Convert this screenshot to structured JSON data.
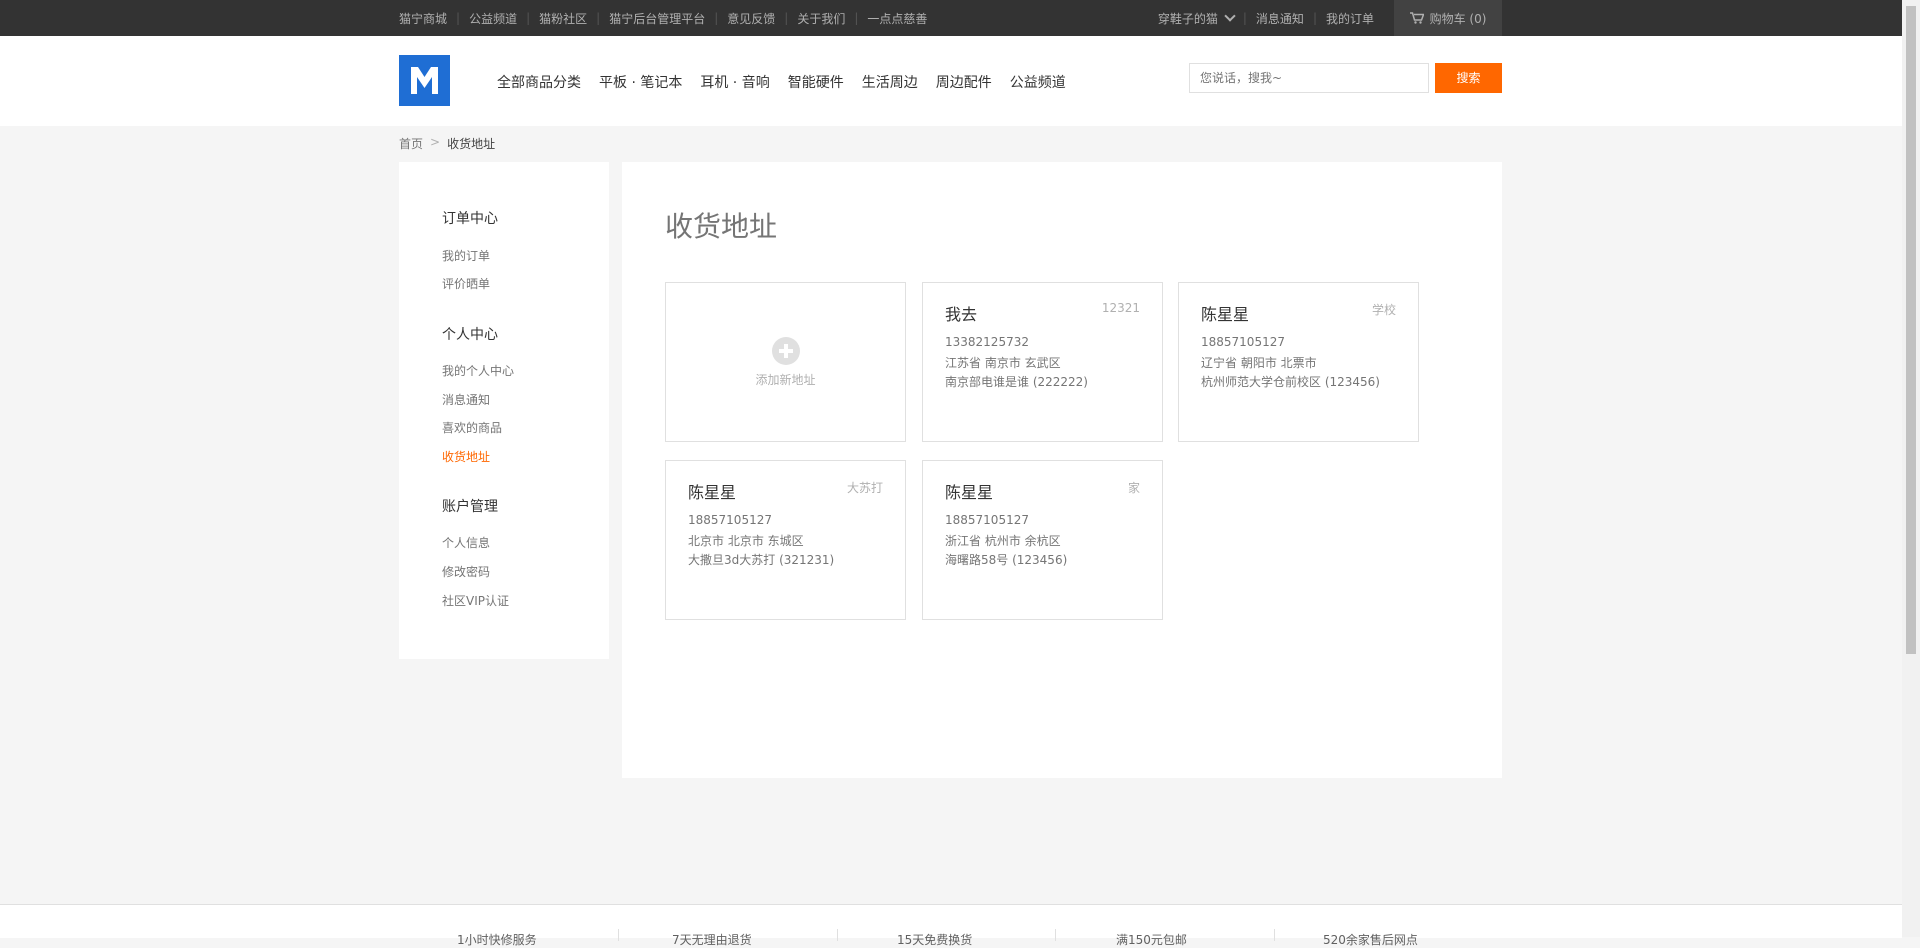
{
  "topbar": {
    "links": [
      "猫宁商城",
      "公益频道",
      "猫粉社区",
      "猫宁后台管理平台",
      "意见反馈",
      "关于我们",
      "一点点慈善"
    ],
    "user_name": "穿鞋子的猫",
    "notifications": "消息通知",
    "my_orders": "我的订单",
    "cart_label": "购物车 (0)"
  },
  "header": {
    "nav": [
      "全部商品分类",
      "平板 · 笔记本",
      "耳机 · 音响",
      "智能硬件",
      "生活周边",
      "周边配件",
      "公益频道"
    ],
    "search_placeholder": "您说话，搜我~",
    "search_button": "搜索"
  },
  "breadcrumb": {
    "home": "首页",
    "separator": ">",
    "current": "收货地址"
  },
  "sidebar": {
    "sections": [
      {
        "title": "订单中心",
        "items": [
          "我的订单",
          "评价晒单"
        ]
      },
      {
        "title": "个人中心",
        "items": [
          "我的个人中心",
          "消息通知",
          "喜欢的商品",
          "收货地址"
        ]
      },
      {
        "title": "账户管理",
        "items": [
          "个人信息",
          "修改密码",
          "社区VIP认证"
        ]
      }
    ],
    "active_item": "收货地址"
  },
  "main": {
    "title": "收货地址",
    "add_label": "添加新地址",
    "addresses": [
      {
        "name": "我去",
        "tag": "12321",
        "phone": "13382125732",
        "region": "江苏省  南京市  玄武区",
        "detail": "南京部电谁是谁 (222222)"
      },
      {
        "name": "陈星星",
        "tag": "学校",
        "phone": "18857105127",
        "region": "辽宁省  朝阳市  北票市",
        "detail": "杭州师范大学仓前校区 (123456)"
      },
      {
        "name": "陈星星",
        "tag": "大苏打",
        "phone": "18857105127",
        "region": "北京市  北京市  东城区",
        "detail": "大撒旦3d大苏打 (321231)"
      },
      {
        "name": "陈星星",
        "tag": "家",
        "phone": "18857105127",
        "region": "浙江省  杭州市  余杭区",
        "detail": "海曙路58号 (123456)"
      }
    ]
  },
  "footer": {
    "items": [
      "1小时快修服务",
      "7天无理由退货",
      "15天免费换货",
      "满150元包邮",
      "520余家售后网点"
    ]
  },
  "colors": {
    "accent": "#ff6700",
    "logo": "#1f6ed4",
    "topbar": "#333333"
  },
  "icons": {
    "cart": "cart-icon",
    "chevron": "chevron-down-icon",
    "add": "plus-circle-icon",
    "logo": "brand-logo-icon"
  }
}
